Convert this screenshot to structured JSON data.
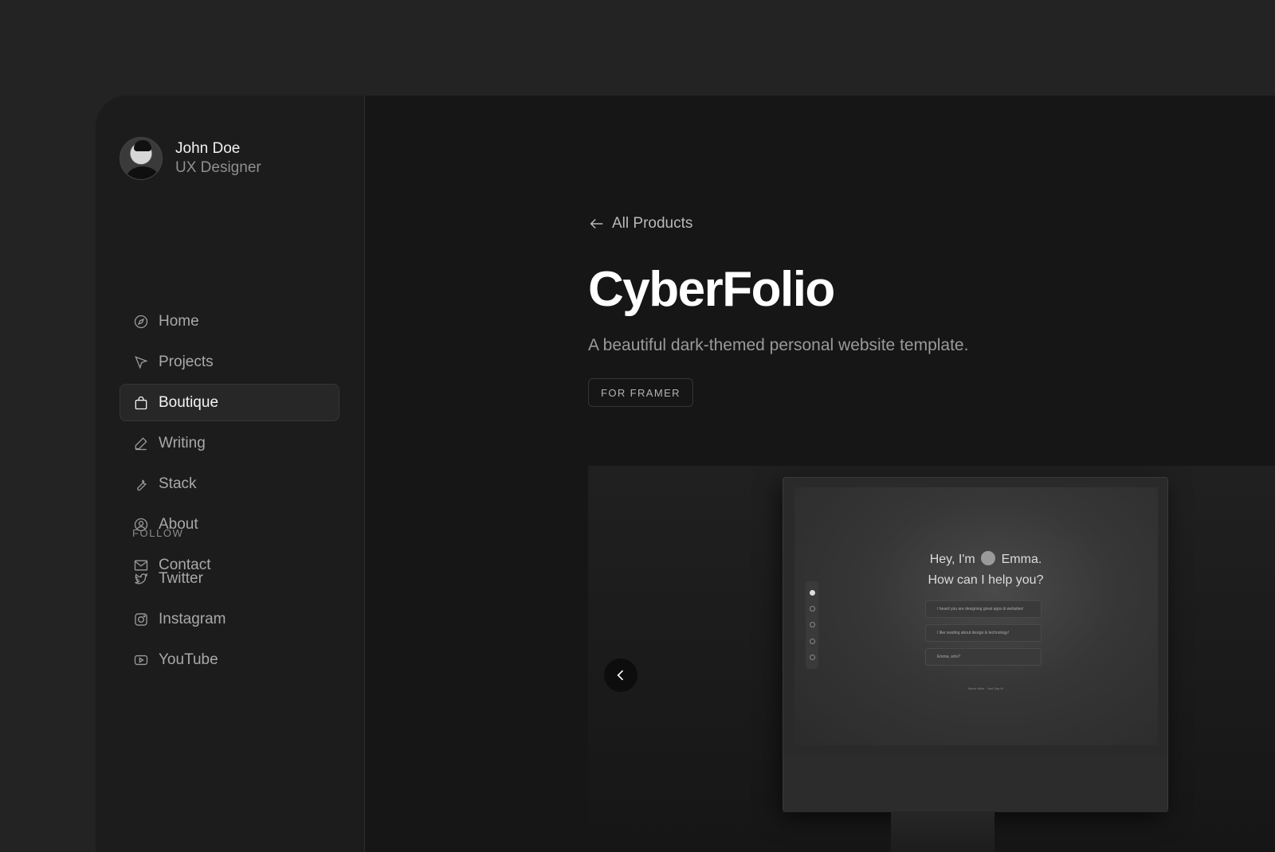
{
  "profile": {
    "name": "John Doe",
    "role": "UX Designer"
  },
  "nav": {
    "items": [
      {
        "label": "Home",
        "icon": "compass-icon"
      },
      {
        "label": "Projects",
        "icon": "cursor-icon"
      },
      {
        "label": "Boutique",
        "icon": "shopping-bag-icon",
        "active": true
      },
      {
        "label": "Writing",
        "icon": "pen-icon"
      },
      {
        "label": "Stack",
        "icon": "wrench-icon"
      },
      {
        "label": "About",
        "icon": "user-circle-icon"
      },
      {
        "label": "Contact",
        "icon": "mail-icon"
      }
    ]
  },
  "follow": {
    "heading": "FOLLOW",
    "items": [
      {
        "label": "Twitter",
        "icon": "twitter-icon"
      },
      {
        "label": "Instagram",
        "icon": "instagram-icon"
      },
      {
        "label": "YouTube",
        "icon": "youtube-icon"
      }
    ]
  },
  "main": {
    "back_label": "All Products",
    "title": "CyberFolio",
    "subtitle": "A beautiful dark-themed personal website template.",
    "tag": "FOR FRAMER"
  },
  "preview": {
    "greeting_line1": "Hey, I'm",
    "greeting_name": "Emma.",
    "greeting_line2": "How can I help you?",
    "rows": [
      "I heard you are designing great apps & websites!",
      "I like reading about design & technology!",
      "Emma, who?"
    ],
    "footer": "Never Mine · Just Say Hi"
  },
  "colors": {
    "background": "#232323",
    "sidebar": "#1c1c1c",
    "main": "#161616",
    "active_item": "#272727"
  }
}
